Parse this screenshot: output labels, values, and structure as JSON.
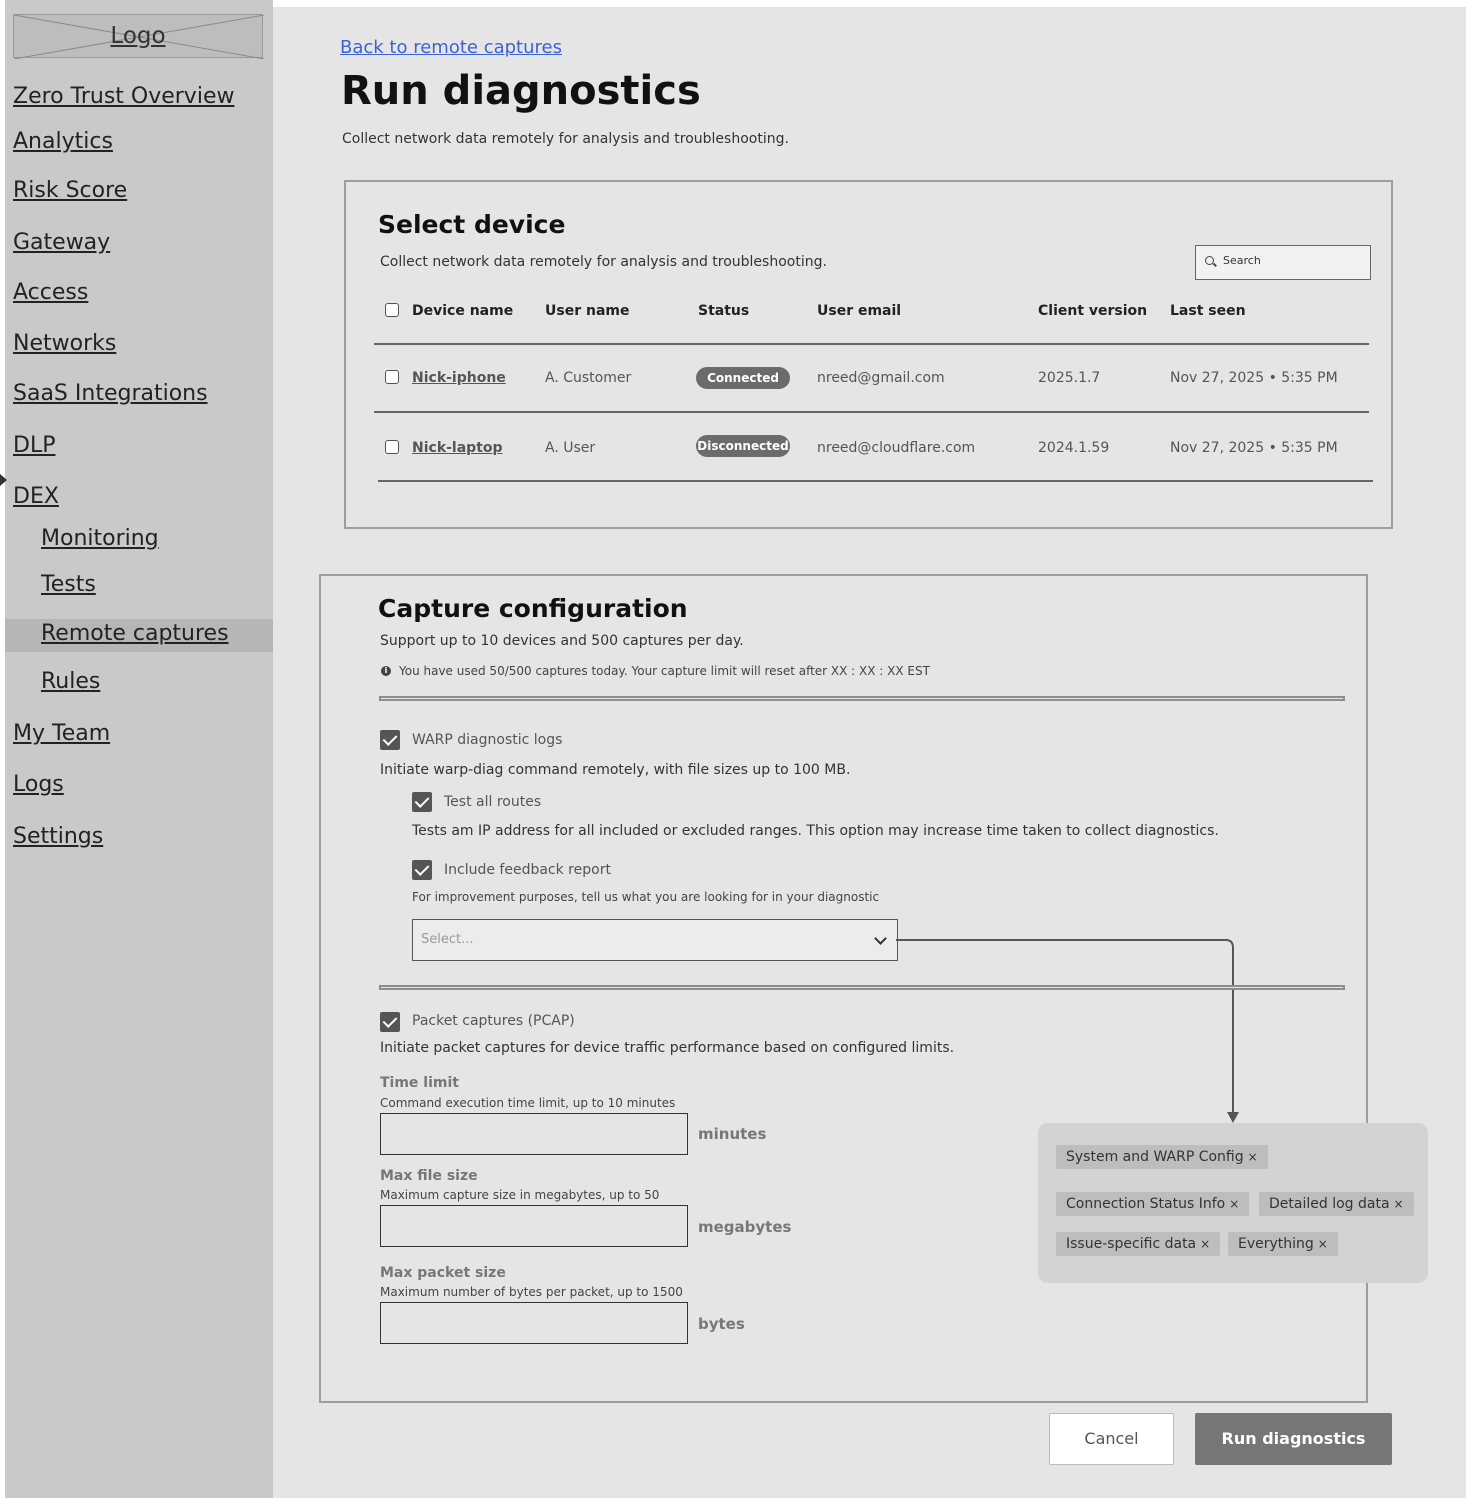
{
  "sidebar": {
    "logo": "Logo",
    "items": [
      {
        "label": "Zero Trust Overview"
      },
      {
        "label": "Analytics"
      },
      {
        "label": "Risk Score"
      },
      {
        "label": "Gateway"
      },
      {
        "label": "Access"
      },
      {
        "label": "Networks"
      },
      {
        "label": "SaaS Integrations"
      },
      {
        "label": "DLP"
      },
      {
        "label": "DEX"
      },
      {
        "label": "Monitoring"
      },
      {
        "label": "Tests"
      },
      {
        "label": "Remote captures",
        "active": true
      },
      {
        "label": "Rules"
      },
      {
        "label": "My Team"
      },
      {
        "label": "Logs"
      },
      {
        "label": "Settings"
      }
    ]
  },
  "header": {
    "back_link": "Back to remote captures",
    "title": "Run diagnostics",
    "description": "Collect network data remotely for analysis and troubleshooting."
  },
  "select_device": {
    "title": "Select device",
    "description": "Collect network data remotely for analysis and troubleshooting.",
    "search_placeholder": "Search",
    "columns": [
      "Device name",
      "User name",
      "Status",
      "User email",
      "Client version",
      "Last seen"
    ],
    "rows": [
      {
        "device": "Nick-iphone",
        "user": "A. Customer",
        "status": "Connected",
        "email": "nreed@gmail.com",
        "version": "2025.1.7",
        "last_seen": "Nov 27, 2025 • 5:35 PM"
      },
      {
        "device": "Nick-laptop",
        "user": "A. User",
        "status": "Disconnected",
        "email": "nreed@cloudflare.com",
        "version": "2024.1.59",
        "last_seen": "Nov 27, 2025 • 5:35 PM"
      }
    ]
  },
  "capture_config": {
    "title": "Capture configuration",
    "description": "Support up to 10 devices and 500 captures per day.",
    "usage_note": "You have used 50/500 captures today. Your capture limit will reset after XX : XX : XX EST",
    "warp": {
      "label": "WARP diagnostic logs",
      "description": "Initiate warp-diag command remotely, with file sizes up to 100 MB.",
      "test_routes_label": "Test all routes",
      "test_routes_desc": "Tests am IP address for all included or excluded ranges. This option may increase time taken to collect diagnostics.",
      "feedback_label": "Include feedback report",
      "feedback_desc": "For improvement purposes, tell us what you are looking for in your diagnostic",
      "select_placeholder": "Select..."
    },
    "pcap": {
      "label": "Packet captures (PCAP)",
      "description": "Initiate packet captures for device traffic performance based on configured limits.",
      "time_limit_label": "Time limit",
      "time_limit_hint": "Command execution time limit, up to 10 minutes",
      "time_limit_unit": "minutes",
      "max_file_label": "Max file size",
      "max_file_hint": "Maximum capture size in megabytes, up to 50",
      "max_file_unit": "megabytes",
      "max_packet_label": "Max packet size",
      "max_packet_hint": "Maximum number of bytes per packet, up to 1500",
      "max_packet_unit": "bytes"
    },
    "options": [
      "System and WARP Config",
      "Connection Status Info",
      "Detailed log data",
      "Issue-specific data",
      "Everything"
    ],
    "remove_symbol": "×"
  },
  "actions": {
    "cancel": "Cancel",
    "run": "Run diagnostics"
  }
}
